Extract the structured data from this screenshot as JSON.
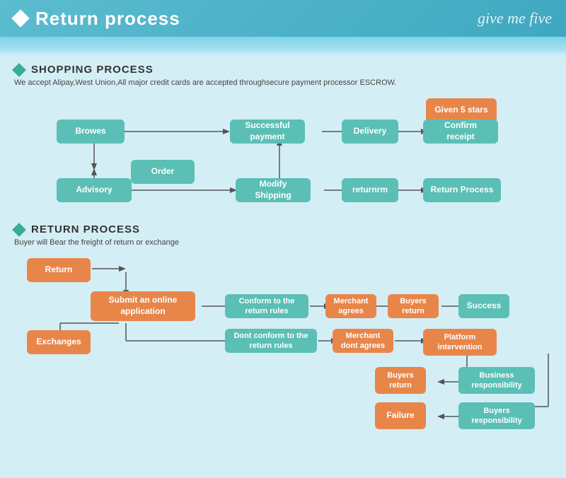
{
  "header": {
    "title": "Return process",
    "brand": "give me five"
  },
  "shopping": {
    "section_title": "SHOPPING PROCESS",
    "desc": "We accept Alipay,West Union,All major credit cards are accepted throughsecure payment processor ESCROW.",
    "boxes": {
      "browes": "Browes",
      "order": "Order",
      "advisory": "Advisory",
      "modify_shipping": "Modify\nShipping",
      "successful_payment": "Successful\npayment",
      "delivery": "Delivery",
      "confirm_receipt": "Confirm\nreceipt",
      "given_5_stars": "Given 5 stars",
      "returnrm": "returnrm",
      "return_process": "Return Process"
    }
  },
  "return": {
    "section_title": "RETURN PROCESS",
    "desc": "Buyer will Bear the freight of return or exchange",
    "boxes": {
      "return": "Return",
      "exchanges": "Exchanges",
      "submit_online": "Submit an online\napplication",
      "conform_rules": "Conform to the\nreturn rules",
      "dont_conform": "Dont conform to the\nreturn rules",
      "merchant_agrees": "Merchant\nagrees",
      "merchant_dont": "Merchant\ndont agrees",
      "buyers_return_top": "Buyers\nreturn",
      "buyers_return_bottom": "Buyers\nreturn",
      "platform_intervention": "Platform\nintervention",
      "success": "Success",
      "business_responsibility": "Business\nresponsibility",
      "buyers_responsibility": "Buyers\nresponsibility",
      "failure": "Failure"
    }
  }
}
